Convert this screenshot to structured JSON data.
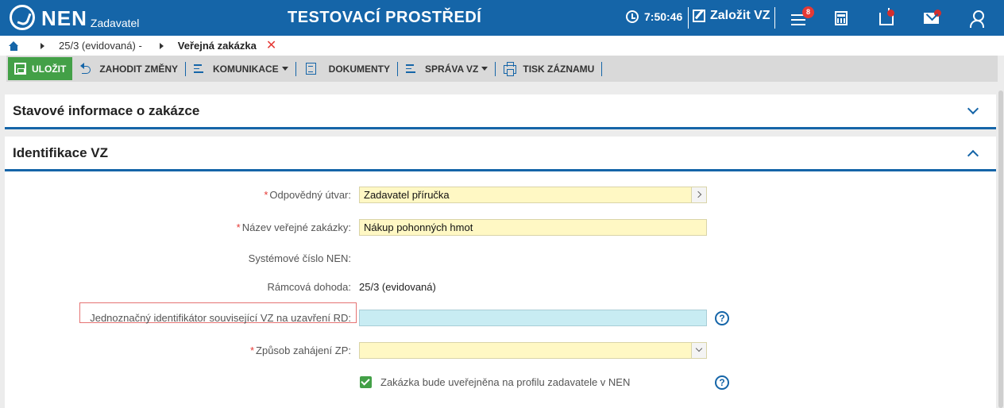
{
  "topbar": {
    "logo_text": "NEN",
    "logo_sub": "Zadavatel",
    "env_title": "TESTOVACÍ PROSTŘEDÍ",
    "time": "7:50:46",
    "create_label": "Založit VZ",
    "menu_badge": "8"
  },
  "breadcrumb": {
    "item1": "25/3 (evidovaná) -",
    "current": "Veřejná zakázka",
    "close": "✕"
  },
  "toolbar": {
    "save": "ULOŽIT",
    "discard": "ZAHODIT ZMĚNY",
    "communication": "KOMUNIKACE",
    "documents": "DOKUMENTY",
    "management": "SPRÁVA VZ",
    "print": "TISK ZÁZNAMU"
  },
  "sections": {
    "status_title": "Stavové informace o zakázce",
    "ident_title": "Identifikace VZ"
  },
  "form": {
    "responsible_unit": {
      "label": "Odpovědný útvar:",
      "value": "Zadavatel příručka"
    },
    "contract_name": {
      "label": "Název veřejné zakázky:",
      "value": "Nákup pohonných hmot"
    },
    "system_number": {
      "label": "Systémové číslo NEN:",
      "value": ""
    },
    "framework": {
      "label": "Rámcová dohoda:",
      "value": "25/3 (evidovaná)"
    },
    "unique_id": {
      "label": "Jednoznačný identifikátor související VZ na uzavření RD:",
      "value": ""
    },
    "start_method": {
      "label": "Způsob zahájení ZP:",
      "value": ""
    },
    "publish": {
      "label": "Zakázka bude uveřejněna na profilu zadavatele v NEN",
      "checked": true
    }
  },
  "help_glyph": "?",
  "required_mark": "*",
  "colors": {
    "topbar": "#1565a8",
    "save_button": "#43a047",
    "required_field": "#fff8c4",
    "active_field": "#c8ecf3",
    "highlight_border": "#e57373"
  }
}
